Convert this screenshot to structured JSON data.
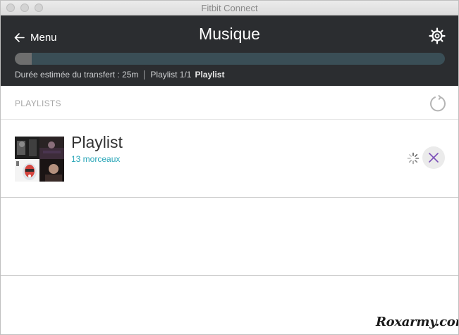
{
  "window": {
    "title": "Fitbit Connect"
  },
  "header": {
    "back_label": "Menu",
    "title": "Musique",
    "progress_fraction": 0.04,
    "transfer_estimate": "Durée estimée du transfert : 25m",
    "playlist_counter": "Playlist 1/1",
    "current_playlist": "Playlist",
    "colors": {
      "background": "#2b2d30",
      "progress_track": "#3a4e56",
      "progress_fill": "#6e6e6e"
    }
  },
  "playlists_section": {
    "label": "PLAYLISTS",
    "refresh_icon": "refresh-icon"
  },
  "playlists": [
    {
      "name": "Playlist",
      "track_count": "13 morceaux",
      "status_icon": "loading-spinner-icon",
      "remove_icon": "close-icon"
    }
  ],
  "watermark": {
    "text": "Roxarmy.com"
  },
  "accent_color": "#2aa6b8",
  "remove_icon_color": "#7b4fb8"
}
